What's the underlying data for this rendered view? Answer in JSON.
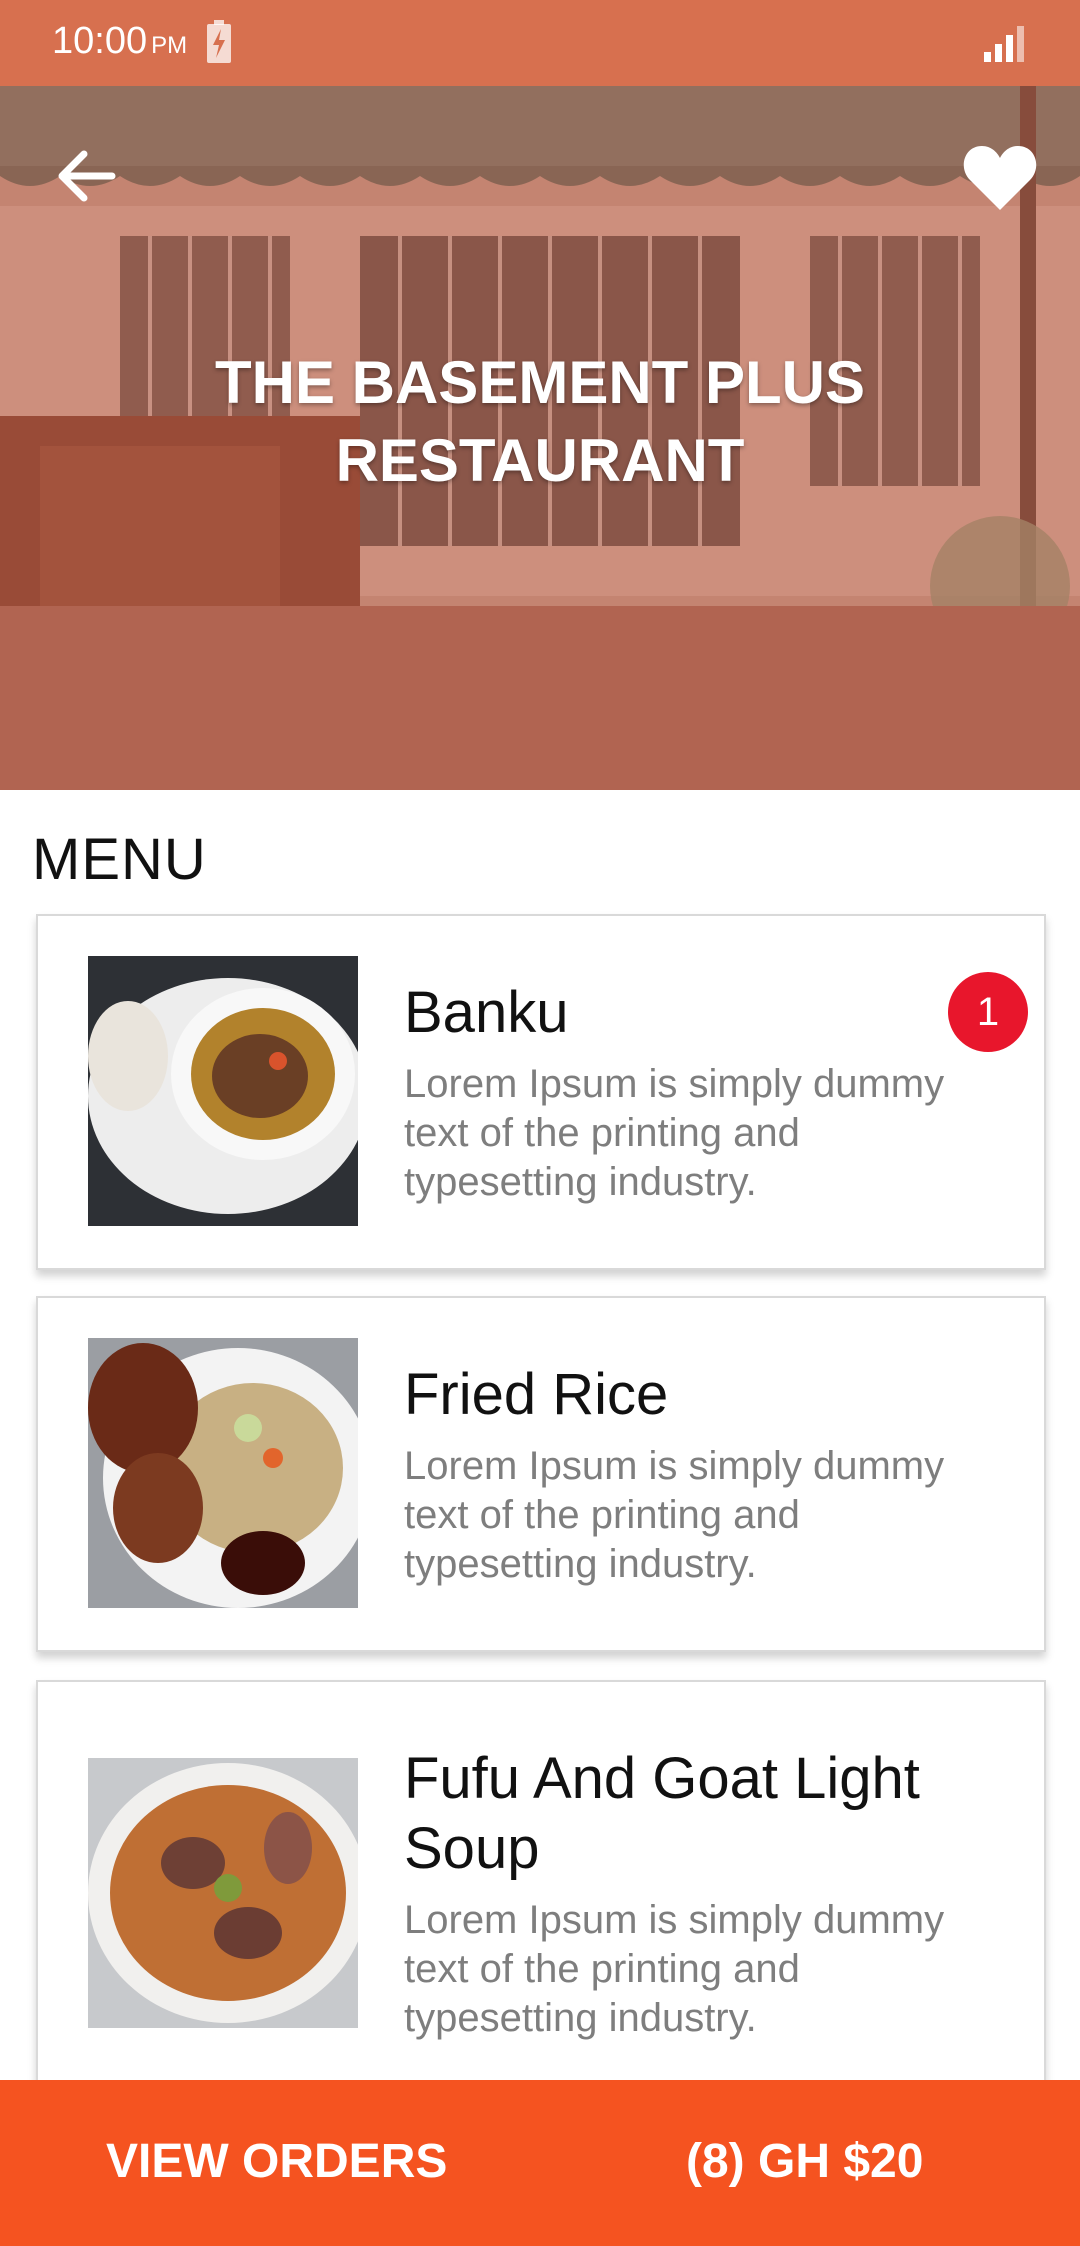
{
  "status_bar": {
    "time": "10:00",
    "ampm": "PM"
  },
  "restaurant": {
    "name_line1": "THE BASEMENT PLUS",
    "name_line2": "RESTAURANT"
  },
  "menu": {
    "heading": "MENU",
    "items": [
      {
        "title": "Banku",
        "description": "Lorem Ipsum is simply dummy text of the printing and typesetting industry.",
        "badge": "1"
      },
      {
        "title": "Fried Rice",
        "description": "Lorem Ipsum is simply dummy text of the printing and typesetting industry."
      },
      {
        "title": "Fufu And Goat Light Soup",
        "description": "Lorem Ipsum is simply dummy text of the printing and typesetting industry."
      }
    ]
  },
  "bottom_bar": {
    "view_orders_label": "VIEW ORDERS",
    "order_summary": "(8) GH $20"
  },
  "colors": {
    "status_bar": "#d7704f",
    "accent": "#f55320",
    "badge": "#e8162c"
  },
  "icons": {
    "back": "arrow-left-icon",
    "favorite": "heart-icon",
    "battery": "battery-charging-icon",
    "signal": "signal-icon"
  }
}
